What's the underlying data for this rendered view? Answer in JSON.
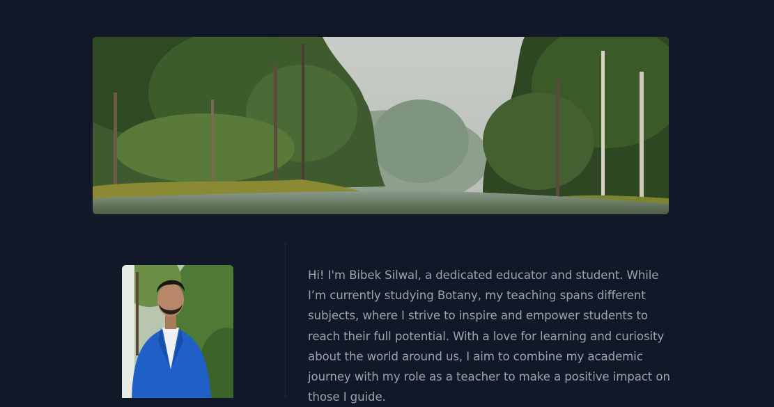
{
  "banner": {
    "alt": "Forest landscape with river and tall trees"
  },
  "profile": {
    "photo_alt": "Portrait of Bibek Silwal in a blue suit"
  },
  "bio": {
    "text": "Hi! I'm Bibek Silwal, a dedicated educator and student. While I’m currently studying Botany, my teaching spans different subjects, where I strive to inspire and empower students to reach their full potential. With a love for learning and curiosity about the world around us, I aim to combine my academic journey with my role as a teacher to make a positive impact on those I guide."
  },
  "colors": {
    "background": "#111827",
    "text": "#9ca3af",
    "divider": "#1f2937"
  }
}
